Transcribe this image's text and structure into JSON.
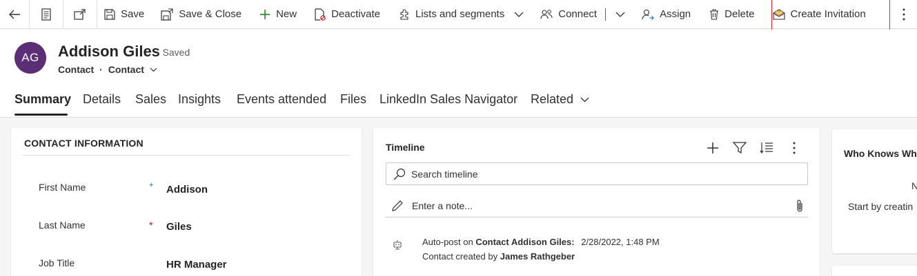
{
  "commandbar": {
    "save": "Save",
    "save_close": "Save & Close",
    "new": "New",
    "deactivate": "Deactivate",
    "lists_segments": "Lists and segments",
    "connect": "Connect",
    "assign": "Assign",
    "delete": "Delete",
    "create_invitation": "Create Invitation",
    "highlight_color": "#e3222a"
  },
  "record": {
    "initials": "AG",
    "name": "Addison Giles",
    "status": "- Saved",
    "entity": "Contact",
    "form": "Contact",
    "avatar_color": "#5c2e76"
  },
  "tabs": [
    "Summary",
    "Details",
    "Sales",
    "Insights",
    "Events attended",
    "Files",
    "LinkedIn Sales Navigator",
    "Related"
  ],
  "contact_info": {
    "title": "CONTACT INFORMATION",
    "fields": [
      {
        "label": "First Name",
        "marker": "+",
        "value": "Addison"
      },
      {
        "label": "Last Name",
        "marker": "*",
        "value": "Giles"
      },
      {
        "label": "Job Title",
        "marker": "",
        "value": "HR Manager"
      }
    ]
  },
  "timeline": {
    "title": "Timeline",
    "search_placeholder": "Search timeline",
    "note_placeholder": "Enter a note...",
    "entry": {
      "prefix": "Auto-post on ",
      "subject": "Contact Addison Giles:",
      "timestamp": "2/28/2022, 1:48 PM",
      "body_prefix": "Contact created by ",
      "author": "James Rathgeber"
    }
  },
  "who_knows": {
    "title": "Who Knows Wh",
    "line1": "N",
    "line2": "Start by creatin"
  }
}
